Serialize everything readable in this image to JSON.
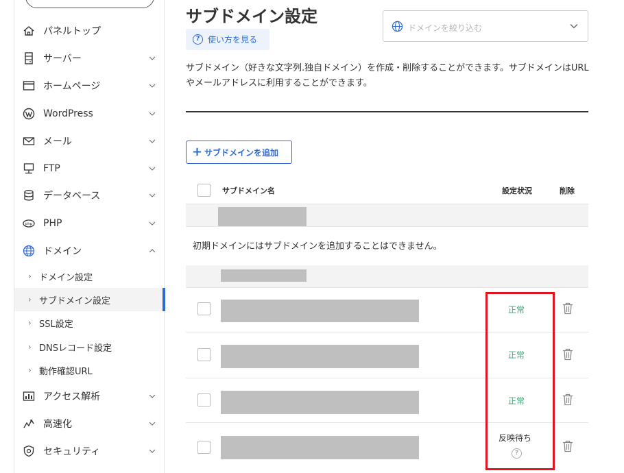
{
  "sidebar": {
    "items": [
      {
        "label": "パネルトップ",
        "icon": "home-icon"
      },
      {
        "label": "サーバー",
        "icon": "server-icon"
      },
      {
        "label": "ホームページ",
        "icon": "window-icon"
      },
      {
        "label": "WordPress",
        "icon": "wordpress-icon"
      },
      {
        "label": "メール",
        "icon": "mail-icon"
      },
      {
        "label": "FTP",
        "icon": "ftp-icon"
      },
      {
        "label": "データベース",
        "icon": "database-icon"
      },
      {
        "label": "PHP",
        "icon": "php-icon"
      },
      {
        "label": "ドメイン",
        "icon": "globe-icon"
      }
    ],
    "domain_sub": [
      {
        "label": "ドメイン設定"
      },
      {
        "label": "サブドメイン設定"
      },
      {
        "label": "SSL設定"
      },
      {
        "label": "DNSレコード設定"
      },
      {
        "label": "動作確認URL"
      }
    ],
    "items_after": [
      {
        "label": "アクセス解析",
        "icon": "chart-icon"
      },
      {
        "label": "高速化",
        "icon": "speed-icon"
      },
      {
        "label": "セキュリティ",
        "icon": "shield-icon"
      }
    ]
  },
  "main": {
    "title": "サブドメイン設定",
    "howto_label": "使い方を見る",
    "filter_placeholder": "ドメインを絞り込む",
    "description": "サブドメイン（好きな文字列.独自ドメイン）を作成・削除することができます。サブドメインはURLやメールアドレスに利用することができます。",
    "add_button_label": "サブドメインを追加",
    "table": {
      "col_name": "サブドメイン名",
      "col_status": "設定状況",
      "col_delete": "削除",
      "initial_domain_note": "初期ドメインにはサブドメインを追加することはできません。",
      "rows": [
        {
          "status": "正常"
        },
        {
          "status": "正常"
        },
        {
          "status": "正常"
        },
        {
          "status": "反映待ち"
        }
      ]
    }
  },
  "colors": {
    "accent": "#2d6bd3",
    "status_ok": "#3aa877",
    "highlight": "#e0141e"
  }
}
